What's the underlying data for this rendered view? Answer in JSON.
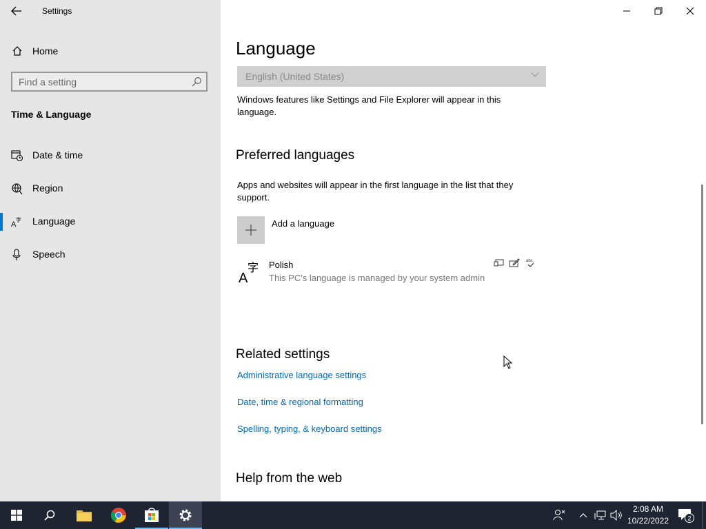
{
  "window": {
    "title": "Settings"
  },
  "sidebar": {
    "home_label": "Home",
    "search_placeholder": "Find a setting",
    "section_label": "Time & Language",
    "items": [
      {
        "label": "Date & time",
        "icon": "calendar-clock-icon",
        "active": false
      },
      {
        "label": "Region",
        "icon": "globe-icon",
        "active": false
      },
      {
        "label": "Language",
        "icon": "language-icon",
        "active": true
      },
      {
        "label": "Speech",
        "icon": "microphone-icon",
        "active": false
      }
    ]
  },
  "main": {
    "title": "Language",
    "display_language_value": "English (United States)",
    "display_language_desc": "Windows features like Settings and File Explorer will appear in this language.",
    "preferred_heading": "Preferred languages",
    "preferred_desc": "Apps and websites will appear in the first language in the list that they support.",
    "add_language_label": "Add a language",
    "languages": [
      {
        "name": "Polish",
        "note": "This PC's language is managed by your system admin"
      }
    ],
    "related_heading": "Related settings",
    "related_links": [
      "Administrative language settings",
      "Date, time & regional formatting",
      "Spelling, typing, & keyboard settings"
    ],
    "help_heading": "Help from the web"
  },
  "taskbar": {
    "time": "2:08 AM",
    "date": "10/22/2022",
    "notification_count": "2",
    "accent_color": "#0078d7"
  }
}
